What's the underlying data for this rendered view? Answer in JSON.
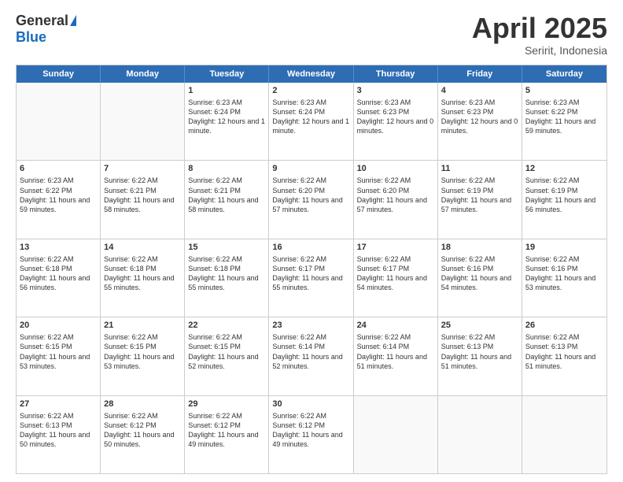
{
  "header": {
    "logo_general": "General",
    "logo_blue": "Blue",
    "title": "April 2025",
    "location": "Seririt, Indonesia"
  },
  "calendar": {
    "days_of_week": [
      "Sunday",
      "Monday",
      "Tuesday",
      "Wednesday",
      "Thursday",
      "Friday",
      "Saturday"
    ],
    "weeks": [
      [
        {
          "day": "",
          "detail": ""
        },
        {
          "day": "",
          "detail": ""
        },
        {
          "day": "1",
          "detail": "Sunrise: 6:23 AM\nSunset: 6:24 PM\nDaylight: 12 hours and 1 minute."
        },
        {
          "day": "2",
          "detail": "Sunrise: 6:23 AM\nSunset: 6:24 PM\nDaylight: 12 hours and 1 minute."
        },
        {
          "day": "3",
          "detail": "Sunrise: 6:23 AM\nSunset: 6:23 PM\nDaylight: 12 hours and 0 minutes."
        },
        {
          "day": "4",
          "detail": "Sunrise: 6:23 AM\nSunset: 6:23 PM\nDaylight: 12 hours and 0 minutes."
        },
        {
          "day": "5",
          "detail": "Sunrise: 6:23 AM\nSunset: 6:22 PM\nDaylight: 11 hours and 59 minutes."
        }
      ],
      [
        {
          "day": "6",
          "detail": "Sunrise: 6:23 AM\nSunset: 6:22 PM\nDaylight: 11 hours and 59 minutes."
        },
        {
          "day": "7",
          "detail": "Sunrise: 6:22 AM\nSunset: 6:21 PM\nDaylight: 11 hours and 58 minutes."
        },
        {
          "day": "8",
          "detail": "Sunrise: 6:22 AM\nSunset: 6:21 PM\nDaylight: 11 hours and 58 minutes."
        },
        {
          "day": "9",
          "detail": "Sunrise: 6:22 AM\nSunset: 6:20 PM\nDaylight: 11 hours and 57 minutes."
        },
        {
          "day": "10",
          "detail": "Sunrise: 6:22 AM\nSunset: 6:20 PM\nDaylight: 11 hours and 57 minutes."
        },
        {
          "day": "11",
          "detail": "Sunrise: 6:22 AM\nSunset: 6:19 PM\nDaylight: 11 hours and 57 minutes."
        },
        {
          "day": "12",
          "detail": "Sunrise: 6:22 AM\nSunset: 6:19 PM\nDaylight: 11 hours and 56 minutes."
        }
      ],
      [
        {
          "day": "13",
          "detail": "Sunrise: 6:22 AM\nSunset: 6:18 PM\nDaylight: 11 hours and 56 minutes."
        },
        {
          "day": "14",
          "detail": "Sunrise: 6:22 AM\nSunset: 6:18 PM\nDaylight: 11 hours and 55 minutes."
        },
        {
          "day": "15",
          "detail": "Sunrise: 6:22 AM\nSunset: 6:18 PM\nDaylight: 11 hours and 55 minutes."
        },
        {
          "day": "16",
          "detail": "Sunrise: 6:22 AM\nSunset: 6:17 PM\nDaylight: 11 hours and 55 minutes."
        },
        {
          "day": "17",
          "detail": "Sunrise: 6:22 AM\nSunset: 6:17 PM\nDaylight: 11 hours and 54 minutes."
        },
        {
          "day": "18",
          "detail": "Sunrise: 6:22 AM\nSunset: 6:16 PM\nDaylight: 11 hours and 54 minutes."
        },
        {
          "day": "19",
          "detail": "Sunrise: 6:22 AM\nSunset: 6:16 PM\nDaylight: 11 hours and 53 minutes."
        }
      ],
      [
        {
          "day": "20",
          "detail": "Sunrise: 6:22 AM\nSunset: 6:15 PM\nDaylight: 11 hours and 53 minutes."
        },
        {
          "day": "21",
          "detail": "Sunrise: 6:22 AM\nSunset: 6:15 PM\nDaylight: 11 hours and 53 minutes."
        },
        {
          "day": "22",
          "detail": "Sunrise: 6:22 AM\nSunset: 6:15 PM\nDaylight: 11 hours and 52 minutes."
        },
        {
          "day": "23",
          "detail": "Sunrise: 6:22 AM\nSunset: 6:14 PM\nDaylight: 11 hours and 52 minutes."
        },
        {
          "day": "24",
          "detail": "Sunrise: 6:22 AM\nSunset: 6:14 PM\nDaylight: 11 hours and 51 minutes."
        },
        {
          "day": "25",
          "detail": "Sunrise: 6:22 AM\nSunset: 6:13 PM\nDaylight: 11 hours and 51 minutes."
        },
        {
          "day": "26",
          "detail": "Sunrise: 6:22 AM\nSunset: 6:13 PM\nDaylight: 11 hours and 51 minutes."
        }
      ],
      [
        {
          "day": "27",
          "detail": "Sunrise: 6:22 AM\nSunset: 6:13 PM\nDaylight: 11 hours and 50 minutes."
        },
        {
          "day": "28",
          "detail": "Sunrise: 6:22 AM\nSunset: 6:12 PM\nDaylight: 11 hours and 50 minutes."
        },
        {
          "day": "29",
          "detail": "Sunrise: 6:22 AM\nSunset: 6:12 PM\nDaylight: 11 hours and 49 minutes."
        },
        {
          "day": "30",
          "detail": "Sunrise: 6:22 AM\nSunset: 6:12 PM\nDaylight: 11 hours and 49 minutes."
        },
        {
          "day": "",
          "detail": ""
        },
        {
          "day": "",
          "detail": ""
        },
        {
          "day": "",
          "detail": ""
        }
      ]
    ]
  }
}
